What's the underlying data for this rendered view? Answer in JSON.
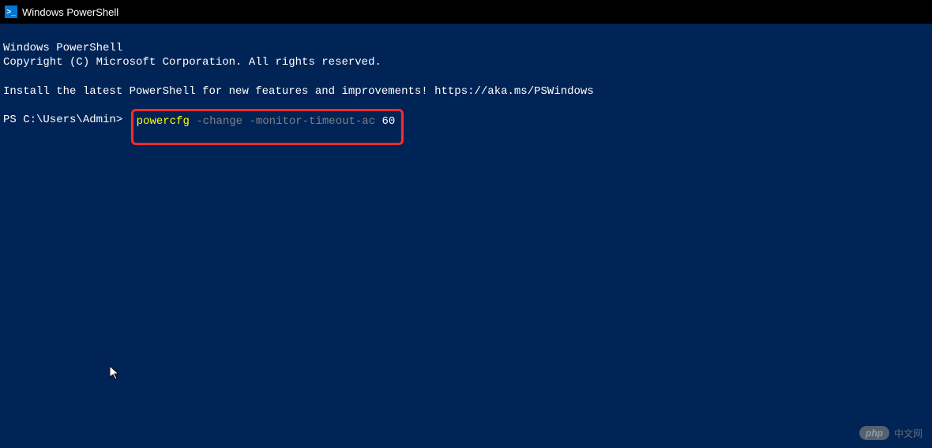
{
  "titlebar": {
    "icon_label": ">_",
    "title": "Windows PowerShell"
  },
  "terminal": {
    "line1": "Windows PowerShell",
    "line2": "Copyright (C) Microsoft Corporation. All rights reserved.",
    "line3": "Install the latest PowerShell for new features and improvements! https://aka.ms/PSWindows",
    "prompt": "PS C:\\Users\\Admin> ",
    "command": {
      "cmd": "powercfg",
      "args_gray": " -change -monitor-timeout-ac",
      "args_white": " 60"
    }
  },
  "watermark": {
    "badge": "php",
    "text": "中文网"
  }
}
